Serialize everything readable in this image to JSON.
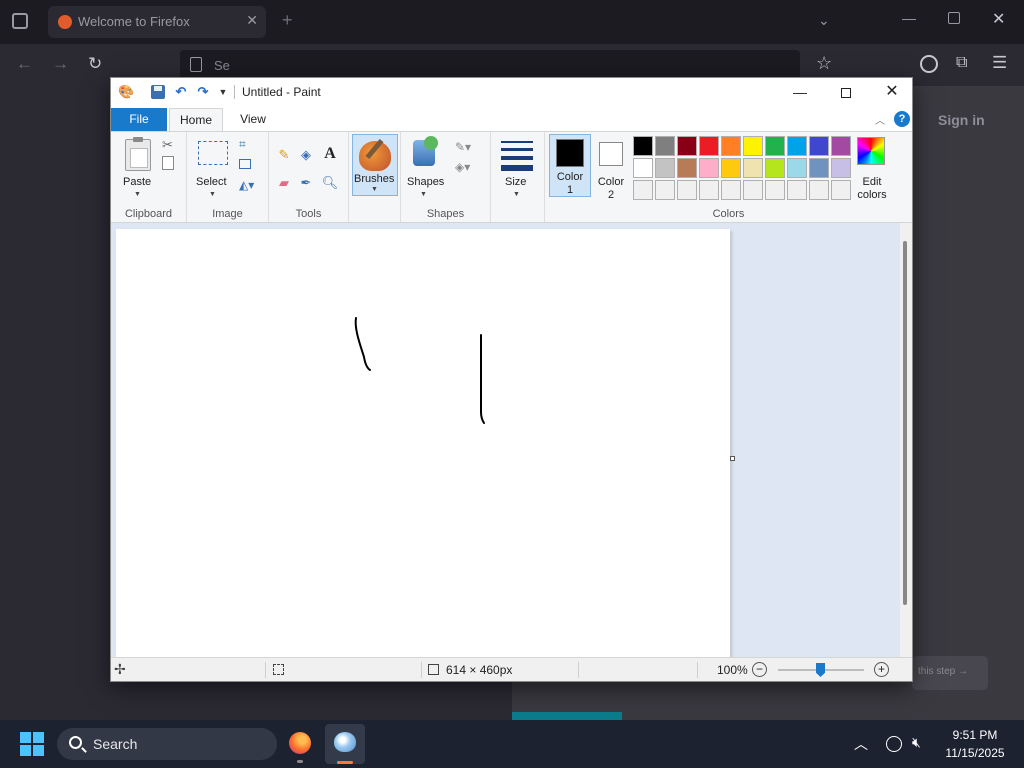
{
  "firefox": {
    "tab_title": "Welcome to Firefox",
    "tab_close": "✕",
    "new_tab": "+",
    "url_placeholder": "Se",
    "sign_in": "Sign in",
    "skip_label": "this step →"
  },
  "paint": {
    "title": "Untitled - Paint",
    "tabs": {
      "file": "File",
      "home": "Home",
      "view": "View"
    },
    "help": "?",
    "groups": {
      "clipboard": "Clipboard",
      "image": "Image",
      "tools": "Tools",
      "brushes_group": "",
      "shapes": "Shapes",
      "size_group": "",
      "colors": "Colors"
    },
    "buttons": {
      "paste": "Paste",
      "select": "Select",
      "brushes": "Brushes",
      "shapes": "Shapes",
      "size": "Size",
      "color1_line1": "Color",
      "color1_line2": "1",
      "color2_line1": "Color",
      "color2_line2": "2",
      "edit_colors_line1": "Edit",
      "edit_colors_line2": "colors"
    },
    "colors": {
      "color1": "#000000",
      "color2": "#ffffff",
      "accent": "#1979ca",
      "palette_row1": [
        "#000000",
        "#7f7f7f",
        "#880015",
        "#ed1c24",
        "#ff7f27",
        "#fff200",
        "#22b14c",
        "#00a2e8",
        "#3f48cc",
        "#a349a4"
      ],
      "palette_row2": [
        "#ffffff",
        "#c3c3c3",
        "#b97a57",
        "#ffaec9",
        "#ffc90e",
        "#efe4b0",
        "#b5e61d",
        "#99d9ea",
        "#7092be",
        "#c8bfe7"
      ],
      "palette_row3": [
        "#f0f0f0",
        "#f0f0f0",
        "#f0f0f0",
        "#f0f0f0",
        "#f0f0f0",
        "#f0f0f0",
        "#f0f0f0",
        "#f0f0f0",
        "#f0f0f0",
        "#f0f0f0"
      ]
    },
    "status": {
      "canvas_size": "614 × 460px",
      "zoom": "100%",
      "zoom_out": "−",
      "zoom_in": "+"
    }
  },
  "taskbar": {
    "search_label": "Search",
    "time": "9:51 PM",
    "date": "11/15/2025"
  }
}
